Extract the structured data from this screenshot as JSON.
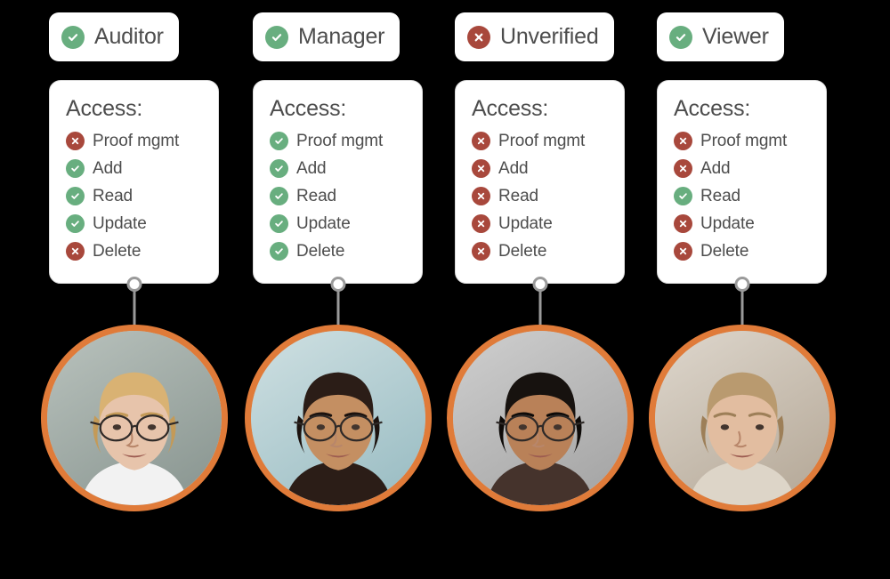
{
  "theme": {
    "background": "#000000",
    "card_background": "#ffffff",
    "card_border": "#dcdcdc",
    "text": "#4d4d4d",
    "allow_color": "#68ae7f",
    "deny_color": "#a8483c",
    "avatar_ring": "#e07b39",
    "connector": "#9a9a9a"
  },
  "icons": {
    "allow": "check-circle-icon",
    "deny": "x-circle-icon"
  },
  "access_title": "Access:",
  "permission_names": [
    "Proof mgmt",
    "Add",
    "Read",
    "Update",
    "Delete"
  ],
  "columns": [
    {
      "role": "Auditor",
      "role_status": "allow",
      "access_title": "Access:",
      "permissions": [
        {
          "label": "Proof mgmt",
          "status": "deny"
        },
        {
          "label": "Add",
          "status": "allow"
        },
        {
          "label": "Read",
          "status": "allow"
        },
        {
          "label": "Update",
          "status": "allow"
        },
        {
          "label": "Delete",
          "status": "deny"
        }
      ],
      "avatar": "avatar-auditor"
    },
    {
      "role": "Manager",
      "role_status": "allow",
      "access_title": "Access:",
      "permissions": [
        {
          "label": "Proof mgmt",
          "status": "allow"
        },
        {
          "label": "Add",
          "status": "allow"
        },
        {
          "label": "Read",
          "status": "allow"
        },
        {
          "label": "Update",
          "status": "allow"
        },
        {
          "label": "Delete",
          "status": "allow"
        }
      ],
      "avatar": "avatar-manager"
    },
    {
      "role": "Unverified",
      "role_status": "deny",
      "access_title": "Access:",
      "permissions": [
        {
          "label": "Proof mgmt",
          "status": "deny"
        },
        {
          "label": "Add",
          "status": "deny"
        },
        {
          "label": "Read",
          "status": "deny"
        },
        {
          "label": "Update",
          "status": "deny"
        },
        {
          "label": "Delete",
          "status": "deny"
        }
      ],
      "avatar": "avatar-unverified"
    },
    {
      "role": "Viewer",
      "role_status": "allow",
      "access_title": "Access:",
      "permissions": [
        {
          "label": "Proof mgmt",
          "status": "deny"
        },
        {
          "label": "Add",
          "status": "deny"
        },
        {
          "label": "Read",
          "status": "allow"
        },
        {
          "label": "Update",
          "status": "deny"
        },
        {
          "label": "Delete",
          "status": "deny"
        }
      ],
      "avatar": "avatar-viewer"
    }
  ]
}
